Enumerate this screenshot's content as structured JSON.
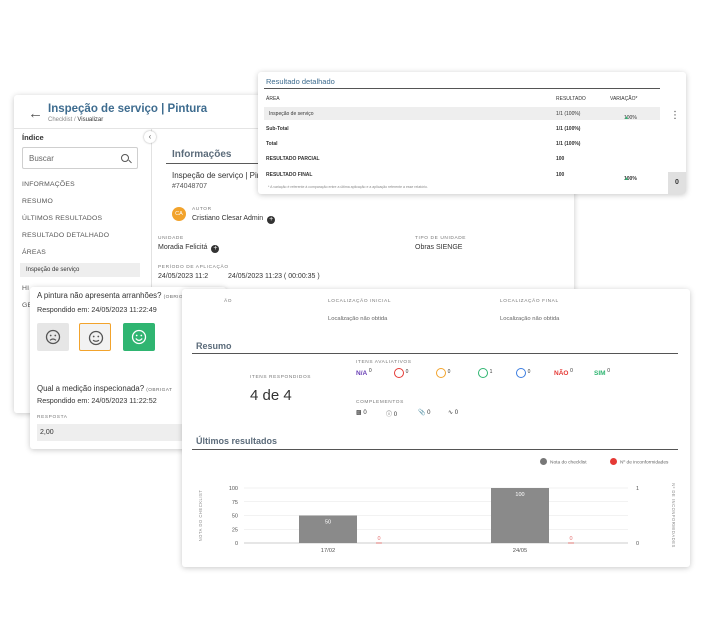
{
  "main": {
    "title": "Inspeção de serviço | Pintura",
    "breadcrumb_parent": "Checklist /",
    "breadcrumb_current": "Visualizar"
  },
  "sidebar": {
    "heading": "Índice",
    "search_placeholder": "Buscar",
    "items": [
      "INFORMAÇÕES",
      "RESUMO",
      "ÚLTIMOS RESULTADOS",
      "RESULTADO DETALHADO",
      "ÁREAS",
      "HI",
      "GE"
    ],
    "sub_item": "Inspeção de serviço"
  },
  "info": {
    "title": "Informações",
    "subtitle": "Inspeção de serviço | Pintura",
    "code": "#74048707",
    "author_initials": "CA",
    "author_label": "AUTOR",
    "author_name": "Cristiano Clesar Admin",
    "unit_label": "UNIDADE",
    "unit_value": "Moradia Felicitá",
    "unit_type_label": "TIPO DE UNIDADE",
    "unit_type_value": "Obras SIENGE",
    "period_label": "PERÍODO DE APLICAÇÃO",
    "period_value": "24/05/2023 11:23 ( 00:00:35 )",
    "period_value_prefix": "24/05/2023 11:2",
    "loc_start_label": "LOCALIZAÇÃO INICIAL",
    "loc_start_value": "Localização não obtida",
    "loc_end_label": "LOCALIZAÇÃO FINAL",
    "loc_end_value": "Localização não obtida",
    "hidden_label_fragment": "ÃO"
  },
  "detail": {
    "title": "Resultado detalhado",
    "columns": [
      "ÁREA",
      "RESULTADO",
      "VARIAÇÃO*"
    ],
    "rows": [
      {
        "area": "Inspeção de serviço",
        "result": "1/1 (100%)",
        "variation": "100%"
      },
      {
        "area": "Sub-Total",
        "result": "1/1 (100%)",
        "variation": ""
      },
      {
        "area": "Total",
        "result": "1/1 (100%)",
        "variation": ""
      },
      {
        "area": "RESULTADO PARCIAL",
        "result": "100",
        "variation": ""
      },
      {
        "area": "RESULTADO FINAL",
        "result": "100",
        "variation": "100%"
      }
    ],
    "note": "* A variação é referente à comparação entre a última aplicação e a aplicação referente a esse relatório.",
    "side_value": "0"
  },
  "questions": [
    {
      "text": "A pintura não apresenta arranhões?",
      "tag": "(OBRIGATÓRIO)",
      "answered": "Respondido em: 24/05/2023 11:22:49"
    },
    {
      "text": "Qual a medição inspecionada?",
      "tag": "(OBRIGAT",
      "answered": "Respondido em: 24/05/2023 11:22:52",
      "answer_label": "RESPOSTA",
      "answer_value": "2,00"
    }
  ],
  "colors": {
    "accent": "#3e6c8f",
    "green": "#2fb571",
    "yellow": "#f2a32c",
    "red": "#e53935",
    "purple": "#6a3fb5",
    "bar": "#8a8a8a"
  },
  "summary": {
    "title": "Resumo",
    "answered_label": "ITENS RESPONDIDOS",
    "answered_value": "4 de 4",
    "eval_label": "ITENS AVALIATIVOS",
    "evals": [
      {
        "label": "N/A",
        "count": "0"
      },
      {
        "icon": "sad-face-icon",
        "count": "0"
      },
      {
        "icon": "neutral-face-icon",
        "count": "0"
      },
      {
        "icon": "happy-face-icon",
        "count": "1"
      },
      {
        "icon": "medal-icon",
        "count": "0"
      },
      {
        "label": "NÃO",
        "count": "0"
      },
      {
        "label": "SIM",
        "count": "0"
      }
    ],
    "complements_label": "COMPLEMENTOS",
    "complements": [
      {
        "icon": "comment-icon",
        "count": "0"
      },
      {
        "icon": "info-icon",
        "count": "0"
      },
      {
        "icon": "attachment-icon",
        "count": "0"
      },
      {
        "icon": "signature-icon",
        "count": "0"
      }
    ]
  },
  "chart_data": {
    "type": "bar",
    "title": "Últimos resultados",
    "categories": [
      "17/02",
      "24/05"
    ],
    "series": [
      {
        "name": "Nota do checklist",
        "values": [
          50,
          100
        ]
      },
      {
        "name": "Nº de inconformidades",
        "values": [
          0,
          0
        ]
      }
    ],
    "ylabel": "NOTA DO CHECKLIST",
    "y2label": "Nº DE INCONFORMIDADES",
    "ylim": [
      0,
      100
    ],
    "yticks": [
      0,
      25,
      50,
      75,
      100
    ],
    "y2ticks": [
      0,
      1
    ],
    "legend": "top-right",
    "grid": true
  }
}
